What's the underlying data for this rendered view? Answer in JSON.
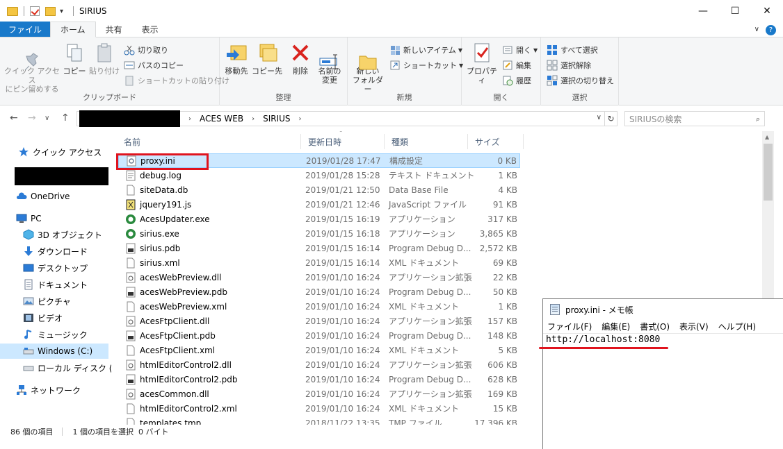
{
  "window": {
    "title": "SIRIUS",
    "controls": {
      "minimize": "—",
      "maximize": "☐",
      "close": "✕"
    },
    "quick_access_dropdown": "▾"
  },
  "ribbon_tabs": [
    "ファイル",
    "ホーム",
    "共有",
    "表示"
  ],
  "ribbon_extra": {
    "collapse": "∨",
    "help": "?"
  },
  "ribbon": {
    "clipboard": {
      "label": "クリップボード",
      "pin": "クイック アクセス\nにピン留めする",
      "copy": "コピー",
      "paste": "貼り付け",
      "cut": "切り取り",
      "copy_path": "パスのコピー",
      "paste_shortcut": "ショートカットの貼り付け"
    },
    "organize": {
      "label": "整理",
      "move_to": "移動先",
      "copy_to": "コピー先",
      "delete": "削除",
      "rename": "名前の\n変更"
    },
    "new": {
      "label": "新規",
      "new_folder": "新しい\nフォルダー",
      "new_item": "新しいアイテム",
      "shortcut": "ショートカット"
    },
    "open": {
      "label": "開く",
      "properties": "プロパティ",
      "open": "開く",
      "edit": "編集",
      "history": "履歴"
    },
    "select": {
      "label": "選択",
      "select_all": "すべて選択",
      "select_none": "選択解除",
      "invert": "選択の切り替え"
    }
  },
  "navigation": {
    "back": "←",
    "forward": "→",
    "recent": "∨",
    "up": "↑",
    "path": [
      "ACES WEB",
      "SIRIUS"
    ],
    "separator": "›",
    "address_dropdown": "∨",
    "refresh": "↻",
    "search_placeholder": "SIRIUSの検索",
    "search_icon": "⌕"
  },
  "sidebar": [
    {
      "label": "クイック アクセス",
      "icon": "star-icon"
    },
    {
      "label": "OneDrive",
      "icon": "cloud-icon"
    },
    {
      "label": "PC",
      "icon": "computer-icon"
    },
    {
      "label": "3D オブジェクト",
      "icon": "cube-icon"
    },
    {
      "label": "ダウンロード",
      "icon": "download-icon"
    },
    {
      "label": "デスクトップ",
      "icon": "desktop-icon"
    },
    {
      "label": "ドキュメント",
      "icon": "document-icon"
    },
    {
      "label": "ピクチャ",
      "icon": "picture-icon"
    },
    {
      "label": "ビデオ",
      "icon": "video-icon"
    },
    {
      "label": "ミュージック",
      "icon": "music-icon"
    },
    {
      "label": "Windows (C:)",
      "icon": "drive-icon"
    },
    {
      "label": "ローカル ディスク (D:)",
      "icon": "drive-icon"
    },
    {
      "label": "ネットワーク",
      "icon": "network-icon"
    }
  ],
  "columns": [
    "名前",
    "更新日時",
    "種類",
    "サイズ"
  ],
  "sort_indicator": "⌃",
  "files": [
    {
      "name": "proxy.ini",
      "date": "2019/01/28 17:47",
      "type": "構成設定",
      "size": "0 KB",
      "icon": "settings-file-icon"
    },
    {
      "name": "debug.log",
      "date": "2019/01/28 15:28",
      "type": "テキスト ドキュメント",
      "size": "1 KB",
      "icon": "text-file-icon"
    },
    {
      "name": "siteData.db",
      "date": "2019/01/21 12:50",
      "type": "Data Base File",
      "size": "4 KB",
      "icon": "file-icon"
    },
    {
      "name": "jquery191.js",
      "date": "2019/01/21 12:46",
      "type": "JavaScript ファイル",
      "size": "91 KB",
      "icon": "script-file-icon"
    },
    {
      "name": "AcesUpdater.exe",
      "date": "2019/01/15 16:19",
      "type": "アプリケーション",
      "size": "317 KB",
      "icon": "app-icon"
    },
    {
      "name": "sirius.exe",
      "date": "2019/01/15 16:18",
      "type": "アプリケーション",
      "size": "3,865 KB",
      "icon": "app-icon"
    },
    {
      "name": "sirius.pdb",
      "date": "2019/01/15 16:14",
      "type": "Program Debug D...",
      "size": "2,572 KB",
      "icon": "pdb-file-icon"
    },
    {
      "name": "sirius.xml",
      "date": "2019/01/15 16:14",
      "type": "XML ドキュメント",
      "size": "69 KB",
      "icon": "file-icon"
    },
    {
      "name": "acesWebPreview.dll",
      "date": "2019/01/10 16:24",
      "type": "アプリケーション拡張",
      "size": "22 KB",
      "icon": "dll-file-icon"
    },
    {
      "name": "acesWebPreview.pdb",
      "date": "2019/01/10 16:24",
      "type": "Program Debug D...",
      "size": "50 KB",
      "icon": "pdb-file-icon"
    },
    {
      "name": "acesWebPreview.xml",
      "date": "2019/01/10 16:24",
      "type": "XML ドキュメント",
      "size": "1 KB",
      "icon": "file-icon"
    },
    {
      "name": "AcesFtpClient.dll",
      "date": "2019/01/10 16:24",
      "type": "アプリケーション拡張",
      "size": "157 KB",
      "icon": "dll-file-icon"
    },
    {
      "name": "AcesFtpClient.pdb",
      "date": "2019/01/10 16:24",
      "type": "Program Debug D...",
      "size": "148 KB",
      "icon": "pdb-file-icon"
    },
    {
      "name": "AcesFtpClient.xml",
      "date": "2019/01/10 16:24",
      "type": "XML ドキュメント",
      "size": "5 KB",
      "icon": "file-icon"
    },
    {
      "name": "htmlEditorControl2.dll",
      "date": "2019/01/10 16:24",
      "type": "アプリケーション拡張",
      "size": "606 KB",
      "icon": "dll-file-icon"
    },
    {
      "name": "htmlEditorControl2.pdb",
      "date": "2019/01/10 16:24",
      "type": "Program Debug D...",
      "size": "628 KB",
      "icon": "pdb-file-icon"
    },
    {
      "name": "acesCommon.dll",
      "date": "2019/01/10 16:24",
      "type": "アプリケーション拡張",
      "size": "169 KB",
      "icon": "dll-file-icon"
    },
    {
      "name": "htmlEditorControl2.xml",
      "date": "2019/01/10 16:24",
      "type": "XML ドキュメント",
      "size": "15 KB",
      "icon": "file-icon"
    },
    {
      "name": "templates.tmp",
      "date": "2018/11/22 13:35",
      "type": "TMP ファイル",
      "size": "17,396 KB",
      "icon": "file-icon"
    }
  ],
  "status": {
    "count": "86 個の項目",
    "selected": "1 個の項目を選択  0 バイト"
  },
  "notepad": {
    "title": "proxy.ini - メモ帳",
    "menu": [
      "ファイル(F)",
      "編集(E)",
      "書式(O)",
      "表示(V)",
      "ヘルプ(H)"
    ],
    "content": "http://localhost:8080"
  },
  "colors": {
    "accent": "#1979ca",
    "highlight": "#e0141e",
    "selection": "#cce8ff"
  }
}
